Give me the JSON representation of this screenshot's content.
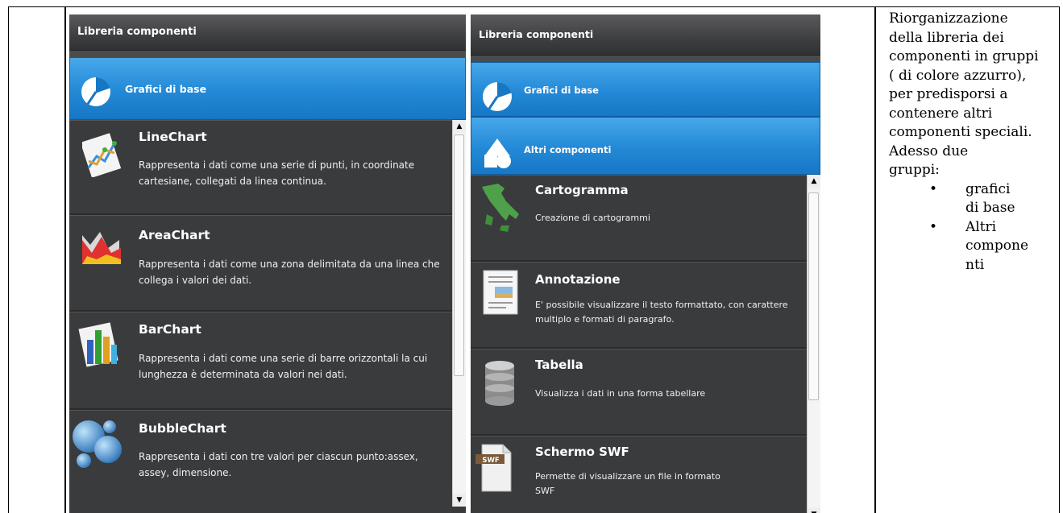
{
  "left_panel": {
    "title": "Libreria componenti",
    "group": "Grafici di base",
    "items": [
      {
        "title": "LineChart",
        "desc": "Rappresenta i dati come una serie di punti, in coordinate cartesiane, collegati da linea continua."
      },
      {
        "title": "AreaChart",
        "desc": "Rappresenta i dati come una zona delimitata da una linea che collega i valori dei dati."
      },
      {
        "title": "BarChart",
        "desc": "Rappresenta i dati come una serie di barre orizzontali la cui lunghezza è determinata da valori nei dati."
      },
      {
        "title": "BubbleChart",
        "desc": "Rappresenta i dati con tre valori per ciascun punto:assex, assey, dimensione."
      }
    ]
  },
  "right_panel": {
    "title": "Libreria componenti",
    "groups": [
      "Grafici di base",
      "Altri componenti"
    ],
    "items": [
      {
        "title": "Cartogramma",
        "desc": "Creazione di cartogrammi"
      },
      {
        "title": "Annotazione",
        "desc": "E' possibile visualizzare il testo formattato, con carattere multiplo e formati di paragrafo."
      },
      {
        "title": "Tabella",
        "desc": "Visualizza i dati in una forma tabellare"
      },
      {
        "title": "Schermo SWF",
        "desc": "Permette di visualizzare un file in formato SWF",
        "badge": "SWF"
      }
    ]
  },
  "side_text": {
    "paragraph": "Riorganizzazione della libreria dei componenti in gruppi ( di colore azzurro), per predisporsi a contenere altri componenti speciali.",
    "line2": "Adesso due gruppi:",
    "bullets": [
      "grafici di base",
      "Altri compone nti"
    ]
  },
  "colors": {
    "group_blue": "#2389d6",
    "panel_dark": "#3a3b3d"
  }
}
